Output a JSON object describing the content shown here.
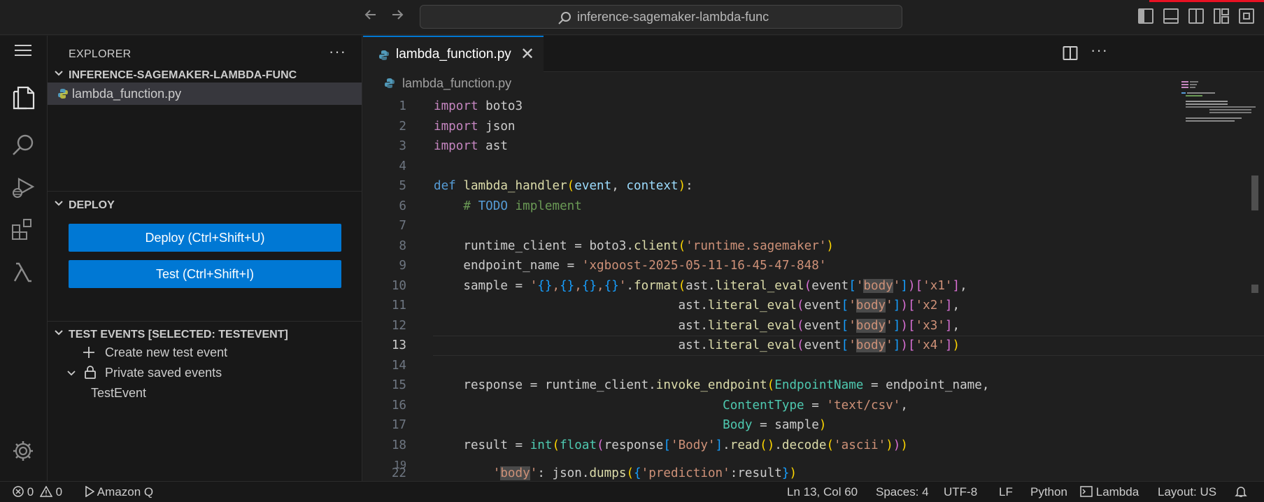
{
  "titlebar": {
    "search_text": "inference-sagemaker-lambda-func",
    "back_icon": "arrow-left-icon",
    "forward_icon": "arrow-right-icon"
  },
  "sidebar": {
    "title": "EXPLORER",
    "more_actions": "···",
    "folder": "INFERENCE-SAGEMAKER-LAMBDA-FUNC",
    "file": "lambda_function.py",
    "deploy_section": "DEPLOY",
    "deploy_button": "Deploy (Ctrl+Shift+U)",
    "test_button": "Test (Ctrl+Shift+I)",
    "test_events_section": "TEST EVENTS [SELECTED: TESTEVENT]",
    "create_event": "Create new test event",
    "private_events": "Private saved events",
    "test_event": "TestEvent"
  },
  "editor": {
    "tab_label": "lambda_function.py",
    "tab_close": "✕",
    "breadcrumb": "lambda_function.py",
    "line_numbers": [
      "1",
      "2",
      "3",
      "4",
      "5",
      "6",
      "7",
      "8",
      "9",
      "10",
      "11",
      "12",
      "13",
      "14",
      "15",
      "16",
      "17",
      "18",
      "19"
    ],
    "sticky_line_number": "22",
    "current_line": "13"
  },
  "status": {
    "errors": "0",
    "warnings": "0",
    "amazon_q": "Amazon Q",
    "position": "Ln 13, Col 60",
    "spaces": "Spaces: 4",
    "encoding": "UTF-8",
    "eol": "LF",
    "language": "Python",
    "lambda": "Lambda",
    "layout": "Layout: US"
  },
  "colors": {
    "accent": "#0078d4",
    "background": "#1f1f1f",
    "sidebar_bg": "#181818"
  }
}
